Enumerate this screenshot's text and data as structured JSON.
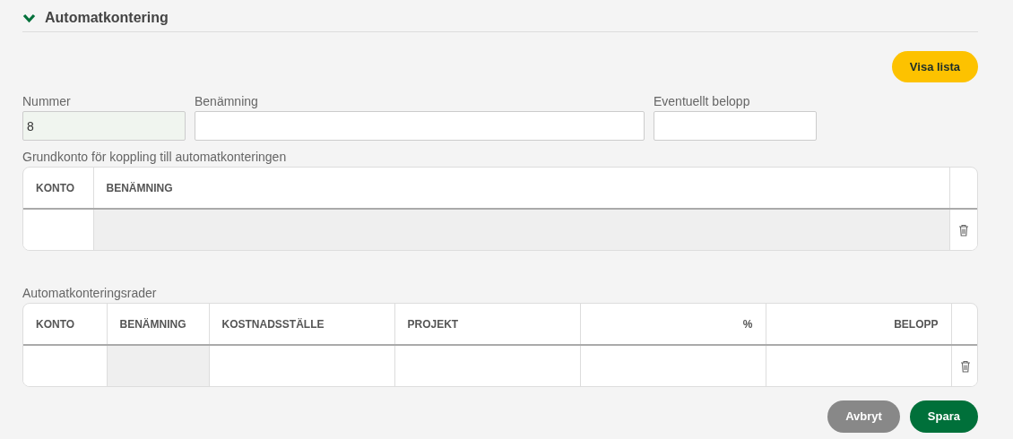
{
  "section": {
    "title": "Automatkontering",
    "expanded": true
  },
  "show_list_button": "Visa lista",
  "fields": [
    {
      "label": "Nummer",
      "value": "8",
      "focused": true
    },
    {
      "label": "Benämning",
      "focused": false
    },
    {
      "label": "Eventuellt belopp",
      "focused": false
    }
  ],
  "tables": [
    {
      "caption": "Grundkonto för koppling till automatkonteringen",
      "columns": [
        {
          "label": "KONTO",
          "numeric": false
        },
        {
          "label": "BENÄMNING",
          "numeric": false
        }
      ],
      "rows": [
        {
          "cells": [
            {
              "readonly": false
            },
            {
              "readonly": true
            }
          ]
        }
      ]
    },
    {
      "caption": "Automatkonteringsrader",
      "columns": [
        {
          "label": "KONTO",
          "numeric": false
        },
        {
          "label": "BENÄMNING",
          "numeric": false
        },
        {
          "label": "KOSTNADSSTÄLLE",
          "numeric": false
        },
        {
          "label": "PROJEKT",
          "numeric": false
        },
        {
          "label": "%",
          "numeric": true
        },
        {
          "label": "BELOPP",
          "numeric": true
        }
      ],
      "rows": [
        {
          "cells": [
            {
              "readonly": false
            },
            {
              "readonly": true
            },
            {
              "readonly": false
            },
            {
              "readonly": false
            },
            {
              "readonly": false
            },
            {
              "readonly": false
            }
          ]
        }
      ]
    }
  ],
  "buttons": [
    {
      "label": "Avbryt",
      "kind": "secondary"
    },
    {
      "label": "Spara",
      "kind": "primary"
    }
  ]
}
